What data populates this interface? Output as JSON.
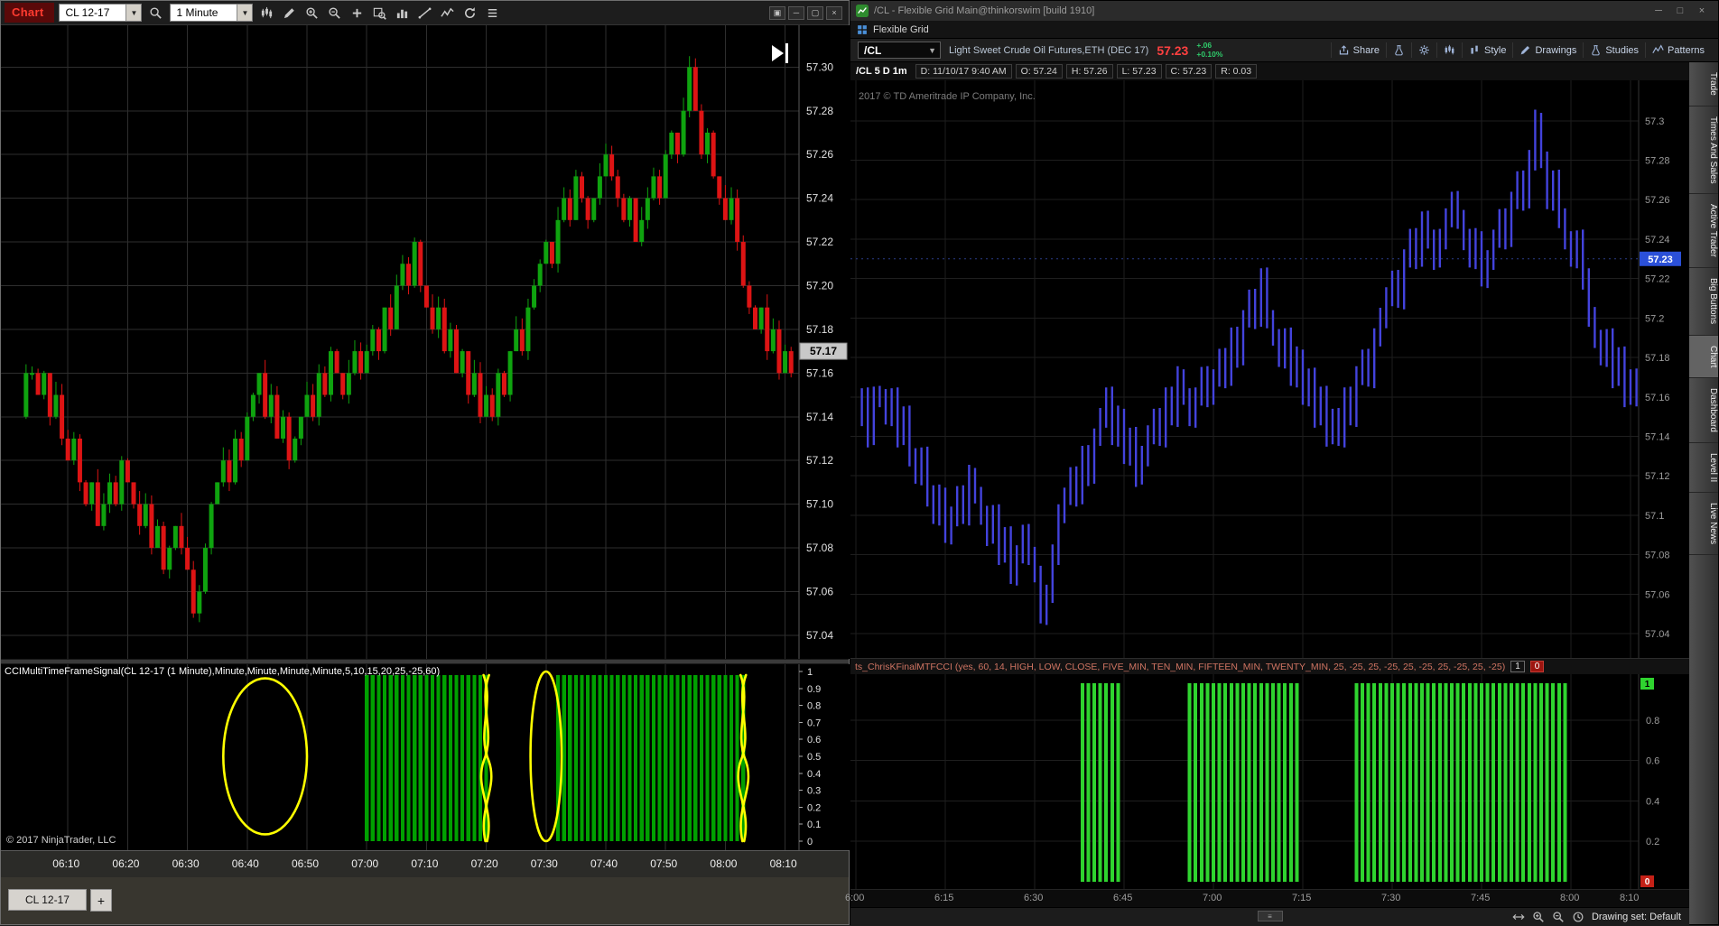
{
  "nt": {
    "toolbar": {
      "tab": "Chart",
      "symbol": "CL 12-17",
      "interval": "1 Minute",
      "icons": [
        "candles",
        "pencil",
        "zoom-in",
        "zoom-out",
        "plus",
        "region-magnifier",
        "histogram",
        "trend",
        "zigzag",
        "refresh",
        "list"
      ],
      "window_buttons": [
        {
          "name": "restore-child",
          "glyph": "▣"
        },
        {
          "name": "minimize",
          "glyph": "─"
        },
        {
          "name": "maximize",
          "glyph": "▢"
        },
        {
          "name": "close",
          "glyph": "×"
        }
      ]
    },
    "indicator": {
      "label": "CCIMultiTimeFrameSignal(CL 12-17 (1 Minute),Minute,Minute,Minute,Minute,5,10,15,20,25,-25,60)",
      "copyright": "© 2017 NinjaTrader, LLC"
    },
    "bottom_tab": "CL 12-17",
    "add_tab": "+"
  },
  "tos": {
    "title": "/CL - Flexible Grid Main@thinkorswim [build 1910]",
    "window_buttons": [
      {
        "name": "minimize",
        "glyph": "─"
      },
      {
        "name": "maximize",
        "glyph": "□"
      },
      {
        "name": "close",
        "glyph": "×"
      }
    ],
    "grid_tab": "Flexible Grid",
    "header": {
      "symbol": "/CL",
      "description": "Light Sweet Crude Oil Futures,ETH (DEC 17)",
      "price": "57.23",
      "change": "+.06",
      "change_pct": "+0.10%",
      "buttons": [
        {
          "name": "share",
          "label": "Share",
          "icon": "share"
        },
        {
          "name": "tests",
          "label": "",
          "icon": "flask"
        },
        {
          "name": "settings",
          "label": "",
          "icon": "gear"
        },
        {
          "name": "chart-mode",
          "label": "",
          "icon": "candles"
        },
        {
          "name": "style",
          "label": "Style",
          "icon": "style"
        },
        {
          "name": "drawings",
          "label": "Drawings",
          "icon": "pencil"
        },
        {
          "name": "studies",
          "label": "Studies",
          "icon": "flask"
        },
        {
          "name": "patterns",
          "label": "Patterns",
          "icon": "pattern"
        }
      ]
    },
    "ohlc": {
      "title": "/CL 5 D 1m",
      "chips": [
        "D: 11/10/17 9:40 AM",
        "O: 57.24",
        "H: 57.26",
        "L: 57.23",
        "C: 57.23",
        "R: 0.03"
      ]
    },
    "copyright": "2017 © TD Ameritrade IP Company, Inc.",
    "sidebar": [
      "Trade",
      "Times And Sales",
      "Active Trader",
      "Big Buttons",
      "Chart",
      "Dashboard",
      "Level II",
      "Live News"
    ],
    "indicator": {
      "label": "ts_ChrisKFinalMTFCCI (yes, 60, 14, HIGH, LOW, CLOSE, FIVE_MIN, TEN_MIN, FIFTEEN_MIN, TWENTY_MIN, 25, -25, 25, -25, 25, -25, 25, -25, 25, -25)",
      "chip_one": "1",
      "chip_zero": "0"
    },
    "bottom_icons": [
      "arrows",
      "zoom-in",
      "zoom-out",
      "clock"
    ],
    "status": "Drawing set: Default"
  },
  "chart_data": [
    {
      "id": "nt-price",
      "type": "candlestick",
      "title": "CL 12-17 1 Minute",
      "time_start": "06:00",
      "interval_min": 1,
      "visible_start": 3,
      "x_ticks": [
        "06:10",
        "06:20",
        "06:30",
        "06:40",
        "06:50",
        "07:00",
        "07:10",
        "07:20",
        "07:30",
        "07:40",
        "07:50",
        "08:00",
        "08:10"
      ],
      "y_ticks": [
        "57.30",
        "57.28",
        "57.26",
        "57.24",
        "57.22",
        "57.20",
        "57.18",
        "57.16",
        "57.14",
        "57.12",
        "57.10",
        "57.08",
        "57.06",
        "57.04"
      ],
      "ylim": [
        57.035,
        57.315
      ],
      "last_price": "57.17",
      "up_color": "#0fa30f",
      "down_color": "#dd1414",
      "closes": [
        57.15,
        57.16,
        57.14,
        57.16,
        57.16,
        57.15,
        57.16,
        57.14,
        57.15,
        57.13,
        57.12,
        57.13,
        57.11,
        57.1,
        57.11,
        57.09,
        57.1,
        57.11,
        57.1,
        57.12,
        57.11,
        57.1,
        57.09,
        57.1,
        57.08,
        57.09,
        57.07,
        57.08,
        57.09,
        57.08,
        57.07,
        57.05,
        57.06,
        57.08,
        57.1,
        57.11,
        57.12,
        57.11,
        57.13,
        57.12,
        57.14,
        57.15,
        57.16,
        57.14,
        57.15,
        57.13,
        57.14,
        57.12,
        57.13,
        57.14,
        57.15,
        57.14,
        57.16,
        57.15,
        57.17,
        57.16,
        57.15,
        57.16,
        57.17,
        57.16,
        57.17,
        57.18,
        57.17,
        57.19,
        57.18,
        57.2,
        57.21,
        57.2,
        57.22,
        57.2,
        57.19,
        57.18,
        57.19,
        57.17,
        57.18,
        57.16,
        57.17,
        57.15,
        57.16,
        57.14,
        57.15,
        57.14,
        57.16,
        57.15,
        57.17,
        57.18,
        57.17,
        57.19,
        57.2,
        57.21,
        57.22,
        57.21,
        57.23,
        57.24,
        57.23,
        57.25,
        57.24,
        57.23,
        57.24,
        57.25,
        57.26,
        57.25,
        57.24,
        57.23,
        57.24,
        57.22,
        57.23,
        57.24,
        57.25,
        57.24,
        57.26,
        57.27,
        57.26,
        57.28,
        57.3,
        57.28,
        57.26,
        57.27,
        57.25,
        57.24,
        57.23,
        57.24,
        57.22,
        57.2,
        57.19,
        57.18,
        57.19,
        57.17,
        57.18,
        57.16,
        57.17,
        57.16
      ]
    },
    {
      "id": "nt-signal",
      "type": "bar",
      "time_start": "06:00",
      "y_ticks": [
        "1",
        "0.9",
        "0.8",
        "0.7",
        "0.6",
        "0.5",
        "0.4",
        "0.3",
        "0.2",
        "0.1",
        "0"
      ],
      "ylim": [
        0,
        1
      ],
      "color": "#00a000",
      "on_value": 1,
      "on_ranges": [
        [
          60,
          80
        ],
        [
          92,
          123
        ]
      ],
      "annotation_color": "#ffff00",
      "annotations": [
        {
          "kind": "ellipse",
          "t": 43,
          "cy": 0.5,
          "rt": 7,
          "ry": 0.46
        },
        {
          "kind": "squiggle",
          "t": 80
        },
        {
          "kind": "ellipse",
          "t": 90,
          "cy": 0.5,
          "rt": 2.6,
          "ry": 0.5
        },
        {
          "kind": "squiggle",
          "t": 123
        }
      ]
    },
    {
      "id": "tos-price",
      "type": "hl-bar",
      "series_ref": 0,
      "time_start": "06:00",
      "x_ticks": [
        "6:00",
        "6:15",
        "6:30",
        "6:45",
        "7:00",
        "7:15",
        "7:30",
        "7:45",
        "8:00",
        "8:10"
      ],
      "y_ticks": [
        "57.3",
        "57.28",
        "57.26",
        "57.24",
        "57.22",
        "57.2",
        "57.18",
        "57.16",
        "57.14",
        "57.12",
        "57.1",
        "57.08",
        "57.06",
        "57.04"
      ],
      "ylim": [
        57.035,
        57.315
      ],
      "last_price": "57.23",
      "color": "#4343dd"
    },
    {
      "id": "tos-signal",
      "type": "bar",
      "time_start": "06:00",
      "y_ticks": [
        "0.8",
        "0.6",
        "0.4",
        "0.2"
      ],
      "ylim": [
        0,
        1
      ],
      "color": "#2fd42f",
      "on_value": 1,
      "on_ranges": [
        [
          38,
          44
        ],
        [
          56,
          74
        ],
        [
          84,
          119
        ]
      ],
      "top_label": "1",
      "bottom_label": "0"
    }
  ]
}
